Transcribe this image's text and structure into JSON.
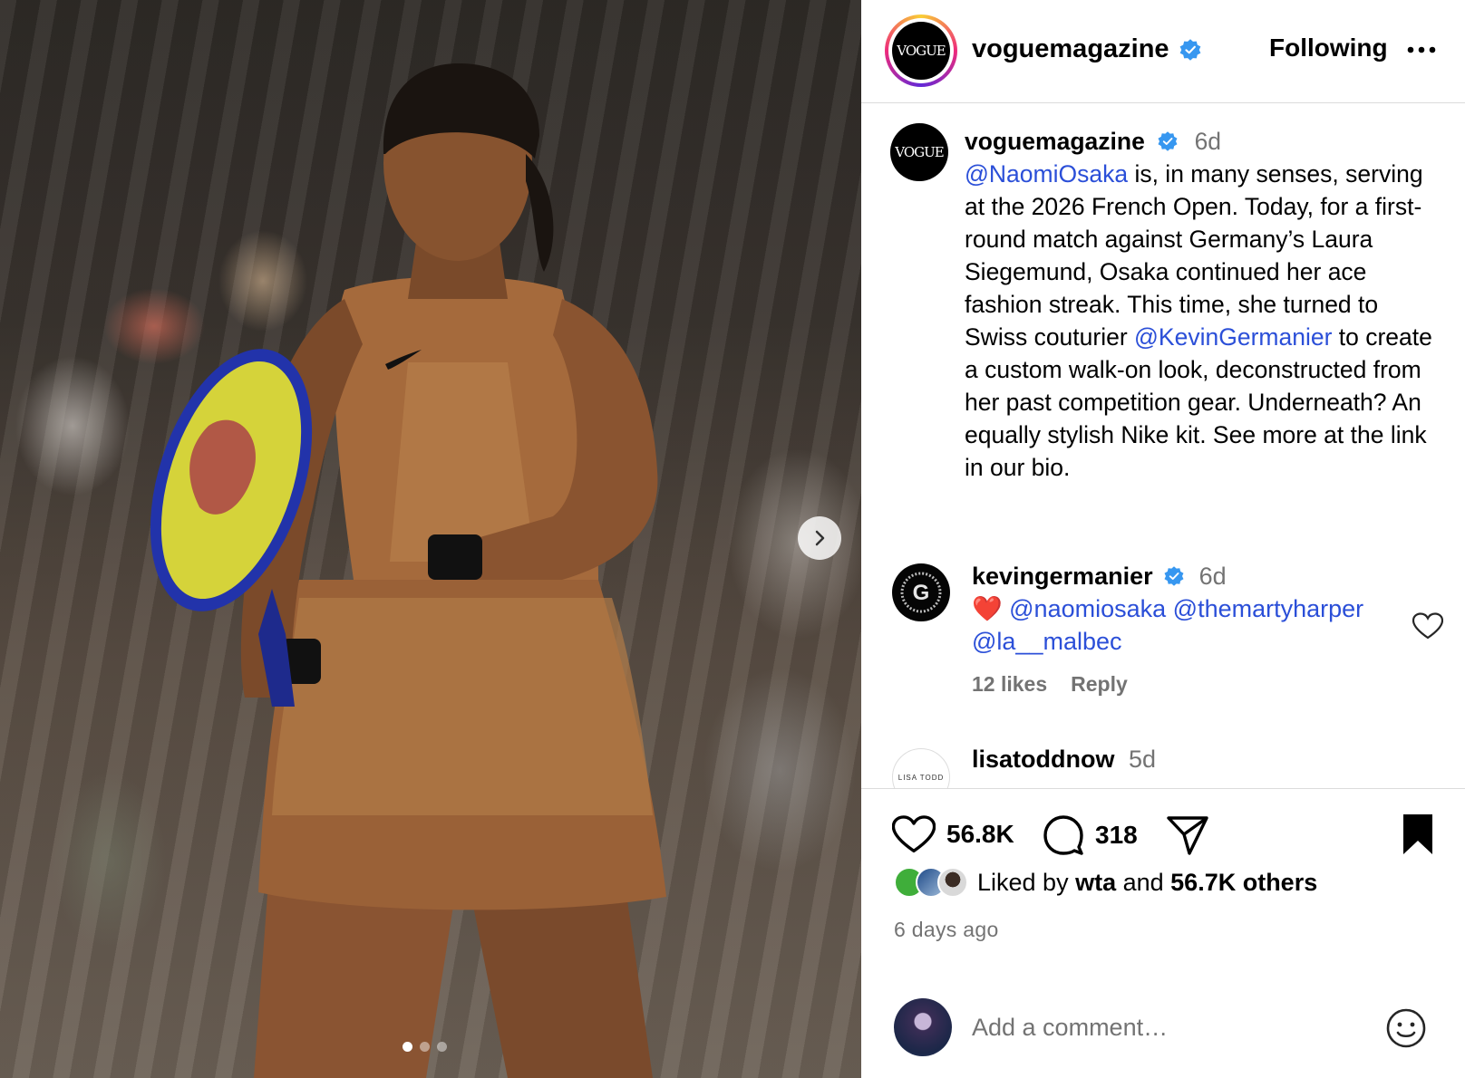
{
  "post": {
    "username": "voguemagazine",
    "follow_status": "Following",
    "logo_text": "VOGUE",
    "caption": {
      "username": "voguemagazine",
      "time": "6d",
      "mention1": "@NaomiOsaka",
      "text1": " is, in many senses, serving at the 2026 French Open. Today, for a first-round match against Germany’s Laura Siegemund, Osaka continued her ace fashion streak. This time, she turned to Swiss couturier ",
      "mention2": "@KevinGermanier",
      "text2": " to create a custom walk-on look, deconstructed from her past competition gear. Underneath? An equally stylish Nike kit. See more at the link in our bio."
    },
    "comments": [
      {
        "username": "kevingermanier",
        "time": "6d",
        "emoji": "❤️",
        "mentions": [
          "@naomiosaka",
          "@themartyharper",
          "@la__malbec"
        ],
        "likes": "12 likes",
        "reply": "Reply",
        "avatar_letter": "G"
      },
      {
        "username": "lisatoddnow",
        "time": "5d",
        "avatar_text": "LISA TODD"
      }
    ],
    "likes_count": "56.8K",
    "comments_count": "318",
    "liked_by_prefix": "Liked by ",
    "liked_by_user": "wta",
    "liked_by_middle": " and ",
    "liked_by_others": "56.7K others",
    "posted_ago": "6 days ago",
    "add_comment_placeholder": "Add a comment…",
    "carousel": {
      "slide_count": 3,
      "active_index": 0
    }
  },
  "colors": {
    "mention": "#2b4fd8",
    "verified": "#3797f0",
    "secondary_text": "#737373",
    "border": "#dbdbdb"
  }
}
